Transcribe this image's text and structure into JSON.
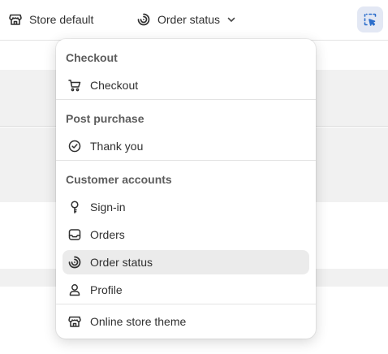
{
  "topbar": {
    "store_label": "Store default",
    "store_icon": "store-icon",
    "page_selector_label": "Order status",
    "page_selector_icon": "order-status-icon",
    "inspect_icon": "inspector-icon"
  },
  "menu": {
    "sections": [
      {
        "label": "Checkout",
        "items": [
          {
            "label": "Checkout",
            "icon": "cart-icon"
          }
        ]
      },
      {
        "label": "Post purchase",
        "items": [
          {
            "label": "Thank you",
            "icon": "check-circle-icon"
          }
        ]
      },
      {
        "label": "Customer accounts",
        "items": [
          {
            "label": "Sign-in",
            "icon": "key-icon"
          },
          {
            "label": "Orders",
            "icon": "inbox-icon"
          },
          {
            "label": "Order status",
            "icon": "order-status-icon",
            "selected": true
          },
          {
            "label": "Profile",
            "icon": "person-icon"
          }
        ]
      }
    ],
    "footer_item": {
      "label": "Online store theme",
      "icon": "store-icon"
    }
  },
  "colors": {
    "accent": "#2c6ecb",
    "selected_bg": "#ebebeb",
    "inspect_bg": "#e3e8f4"
  }
}
